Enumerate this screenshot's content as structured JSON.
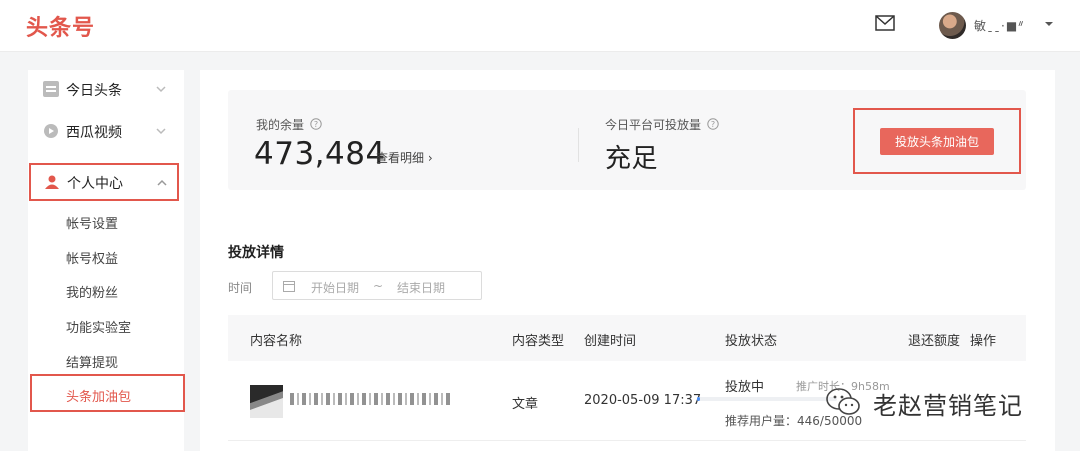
{
  "header": {
    "logo": "头条号",
    "username": "敏ˍˍ·■ᐥ"
  },
  "sidebar": {
    "groups": [
      {
        "label": "今日头条"
      },
      {
        "label": "西瓜视频"
      },
      {
        "label": "个人中心"
      }
    ],
    "sub_items": [
      {
        "label": "帐号设置"
      },
      {
        "label": "帐号权益"
      },
      {
        "label": "我的粉丝"
      },
      {
        "label": "功能实验室"
      },
      {
        "label": "结算提现"
      },
      {
        "label": "头条加油包"
      }
    ]
  },
  "summary": {
    "balance_label": "我的余量",
    "balance_value": "473,484",
    "detail_link": "查看明细 ›",
    "platform_label": "今日平台可投放量",
    "platform_value": "充足",
    "boost_button": "投放头条加油包"
  },
  "details": {
    "title": "投放详情",
    "time_label": "时间",
    "start_placeholder": "开始日期",
    "separator": "~",
    "end_placeholder": "结束日期"
  },
  "table": {
    "headers": [
      "内容名称",
      "内容类型",
      "创建时间",
      "投放状态",
      "退还额度",
      "操作"
    ],
    "rows": [
      {
        "type": "文章",
        "created": "2020-05-09 17:37",
        "status": "投放中",
        "duration": "推广时长：9h58m",
        "recommend": "推荐用户量：446/50000",
        "progress": 0.0089
      }
    ]
  },
  "watermark": {
    "text": "老赵营销笔记"
  },
  "colors": {
    "brand": "#e2574c",
    "progress": "#4a8cf0"
  }
}
